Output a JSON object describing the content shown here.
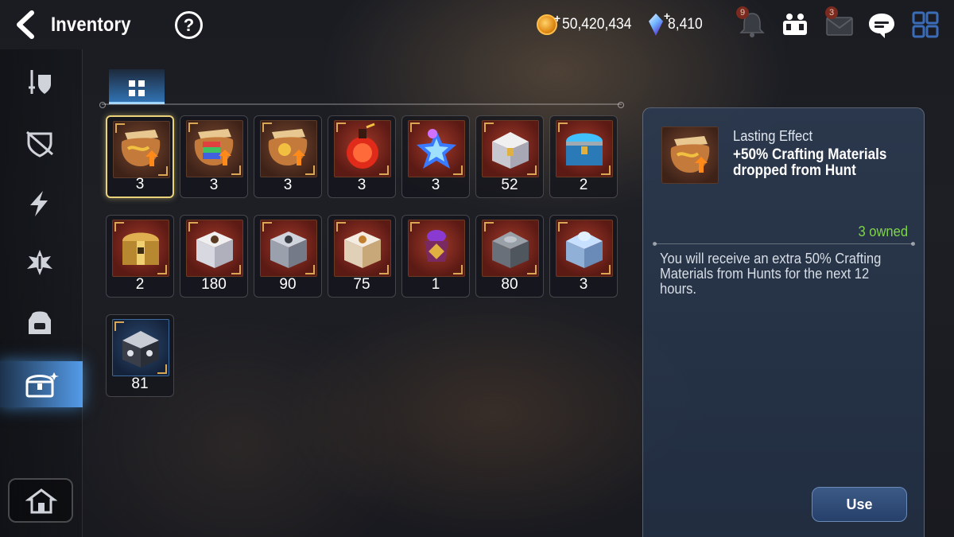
{
  "header": {
    "title": "Inventory",
    "help_label": "?",
    "gold": "50,420,434",
    "crystals": "8,410",
    "notification_badge": "9",
    "mail_badge": "3",
    "plus_sign": "+"
  },
  "sidebar": {
    "tabs": [
      {
        "icon": "equipment-icon",
        "active": false
      },
      {
        "icon": "artifact-icon",
        "active": false
      },
      {
        "icon": "catalyst-icon",
        "active": false
      },
      {
        "icon": "material-icon",
        "active": false
      },
      {
        "icon": "backpack-icon",
        "active": false
      },
      {
        "icon": "chest-icon",
        "active": true
      }
    ],
    "bottom_icon": "house-icon"
  },
  "grid": {
    "tab_icon": "grid-icon",
    "items": [
      {
        "icon": "hunt-scroll-icon",
        "count": "3",
        "bg": "brown",
        "selected": true
      },
      {
        "icon": "rainbow-scroll-icon",
        "count": "3",
        "bg": "brown"
      },
      {
        "icon": "gold-scroll-icon",
        "count": "3",
        "bg": "brown"
      },
      {
        "icon": "red-potion-icon",
        "count": "3",
        "bg": "red"
      },
      {
        "icon": "star-potion-icon",
        "count": "3",
        "bg": "red"
      },
      {
        "icon": "white-chest-icon",
        "count": "52",
        "bg": "red"
      },
      {
        "icon": "blue-chest-icon",
        "count": "2",
        "bg": "red"
      },
      {
        "icon": "gold-chest-icon",
        "count": "2",
        "bg": "red"
      },
      {
        "icon": "white-box-icon",
        "count": "180",
        "bg": "red"
      },
      {
        "icon": "silver-box-icon",
        "count": "90",
        "bg": "red"
      },
      {
        "icon": "ornate-box-icon",
        "count": "75",
        "bg": "red"
      },
      {
        "icon": "charm-icon",
        "count": "1",
        "bg": "red"
      },
      {
        "icon": "steel-box-icon",
        "count": "80",
        "bg": "red"
      },
      {
        "icon": "frost-box-icon",
        "count": "3",
        "bg": "red"
      },
      {
        "icon": "dark-box-icon",
        "count": "81",
        "bg": "blue"
      }
    ]
  },
  "detail": {
    "label": "Lasting Effect",
    "effect": "+50% Crafting Materials dropped from Hunt",
    "owned": "3 owned",
    "description": "You will receive an extra 50% Crafting Materials from Hunts for the next 12 hours.",
    "use_label": "Use"
  },
  "colors": {
    "owned_green": "#7ed54a",
    "selected_gold": "#e9d27a",
    "active_blue": "#5aaaff"
  }
}
